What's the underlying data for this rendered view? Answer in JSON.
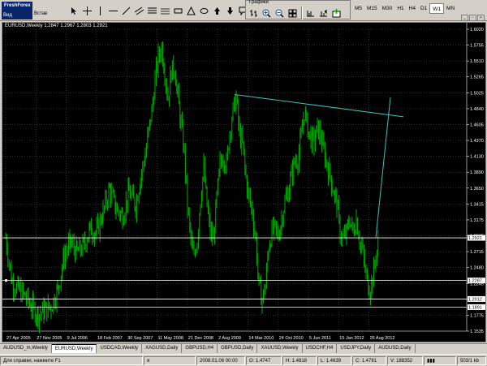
{
  "app": {
    "name": "FreshForex",
    "menu": [
      "Вид",
      "Встав"
    ]
  },
  "floating_toolbar": {
    "title": "Графики"
  },
  "periods": [
    {
      "label": "M5",
      "active": false
    },
    {
      "label": "M15",
      "active": false
    },
    {
      "label": "M30",
      "active": false
    },
    {
      "label": "H1",
      "active": false
    },
    {
      "label": "H4",
      "active": false
    },
    {
      "label": "D1",
      "active": false
    },
    {
      "label": "W1",
      "active": true
    },
    {
      "label": "MN",
      "active": false
    }
  ],
  "chart": {
    "header": "EURUSD,Weekly  1.2847 1.2967 1.2803 1.2921",
    "colors": {
      "background": "#000000",
      "bars": "#00c000",
      "grid": "#5a5a5a",
      "trendline": "#40c0c0",
      "hline": "#ffffff",
      "label": "#ffffff"
    }
  },
  "chart_data": {
    "type": "bar",
    "symbol": "EURUSD",
    "timeframe": "Weekly",
    "ohlc_last": {
      "open": 1.2847,
      "high": 1.2967,
      "low": 1.2803,
      "close": 1.2921
    },
    "ylim": [
      1.1535,
      1.602
    ],
    "y_ticks": [
      "1.6020",
      "1.5755",
      "1.5510",
      "1.5265",
      "1.5025",
      "1.4840",
      "1.4605",
      "1.4370",
      "1.4130",
      "1.3890",
      "1.3650",
      "1.3415",
      "1.3175",
      "1.2935",
      "1.2715",
      "1.2480",
      "1.2245",
      "1.2010",
      "1.1775",
      "1.1535"
    ],
    "x_ticks": [
      "27 Apr 2005",
      "27 Nov 2005",
      "9 Jul 2006",
      "18 Feb 2007",
      "30 Sep 2007",
      "11 May 2008",
      "21 Dec 2008",
      "2 Aug 2009",
      "14 Mar 2010",
      "24 Oct 2010",
      "5 Jun 2011",
      "15 Jan 2012",
      "26 Aug 2012"
    ],
    "price_path": [
      [
        0,
        1.292
      ],
      [
        8,
        1.225
      ],
      [
        16,
        1.215
      ],
      [
        24,
        1.205
      ],
      [
        32,
        1.19
      ],
      [
        40,
        1.178
      ],
      [
        48,
        1.185
      ],
      [
        56,
        1.19
      ],
      [
        64,
        1.215
      ],
      [
        72,
        1.265
      ],
      [
        80,
        1.285
      ],
      [
        88,
        1.27
      ],
      [
        96,
        1.28
      ],
      [
        104,
        1.305
      ],
      [
        112,
        1.3
      ],
      [
        120,
        1.33
      ],
      [
        128,
        1.365
      ],
      [
        136,
        1.335
      ],
      [
        144,
        1.325
      ],
      [
        152,
        1.36
      ],
      [
        160,
        1.34
      ],
      [
        166,
        1.38
      ],
      [
        172,
        1.415
      ],
      [
        176,
        1.45
      ],
      [
        180,
        1.48
      ],
      [
        184,
        1.525
      ],
      [
        188,
        1.56
      ],
      [
        192,
        1.575
      ],
      [
        196,
        1.54
      ],
      [
        200,
        1.5
      ],
      [
        204,
        1.54
      ],
      [
        208,
        1.545
      ],
      [
        212,
        1.5
      ],
      [
        216,
        1.46
      ],
      [
        220,
        1.42
      ],
      [
        224,
        1.34
      ],
      [
        228,
        1.29
      ],
      [
        232,
        1.26
      ],
      [
        236,
        1.29
      ],
      [
        240,
        1.35
      ],
      [
        244,
        1.395
      ],
      [
        248,
        1.34
      ],
      [
        252,
        1.3
      ],
      [
        256,
        1.29
      ],
      [
        260,
        1.35
      ],
      [
        264,
        1.4
      ],
      [
        268,
        1.415
      ],
      [
        272,
        1.4
      ],
      [
        276,
        1.45
      ],
      [
        280,
        1.48
      ],
      [
        284,
        1.5
      ],
      [
        288,
        1.445
      ],
      [
        292,
        1.43
      ],
      [
        296,
        1.38
      ],
      [
        300,
        1.35
      ],
      [
        304,
        1.33
      ],
      [
        308,
        1.29
      ],
      [
        312,
        1.22
      ],
      [
        316,
        1.2
      ],
      [
        320,
        1.22
      ],
      [
        324,
        1.28
      ],
      [
        328,
        1.3
      ],
      [
        332,
        1.305
      ],
      [
        336,
        1.295
      ],
      [
        340,
        1.32
      ],
      [
        344,
        1.345
      ],
      [
        348,
        1.36
      ],
      [
        352,
        1.385
      ],
      [
        356,
        1.405
      ],
      [
        360,
        1.41
      ],
      [
        364,
        1.44
      ],
      [
        368,
        1.48
      ],
      [
        372,
        1.455
      ],
      [
        376,
        1.44
      ],
      [
        380,
        1.435
      ],
      [
        384,
        1.455
      ],
      [
        388,
        1.445
      ],
      [
        392,
        1.42
      ],
      [
        396,
        1.4
      ],
      [
        400,
        1.385
      ],
      [
        404,
        1.36
      ],
      [
        408,
        1.345
      ],
      [
        412,
        1.3
      ],
      [
        416,
        1.29
      ],
      [
        420,
        1.3
      ],
      [
        424,
        1.32
      ],
      [
        428,
        1.3
      ],
      [
        432,
        1.32
      ],
      [
        436,
        1.29
      ],
      [
        440,
        1.27
      ],
      [
        444,
        1.235
      ],
      [
        448,
        1.215
      ],
      [
        452,
        1.23
      ],
      [
        456,
        1.265
      ],
      [
        460,
        1.29
      ]
    ],
    "trendline": {
      "start": [
        286,
        1.505
      ],
      "end": [
        494,
        1.472
      ]
    },
    "projection_line": {
      "start": [
        460,
        1.2921
      ],
      "end": [
        478,
        1.501
      ]
    },
    "hlines": [
      {
        "price": 1.2921,
        "label": "1.2921"
      },
      {
        "price": 1.2287,
        "label": "1.2287"
      },
      {
        "price": 1.2012,
        "label": "1.2012"
      },
      {
        "price": 1.1891,
        "label": "1.1891"
      }
    ],
    "grid": true
  },
  "tabs": [
    {
      "label": "AUDUSD_m,Weekly",
      "active": false
    },
    {
      "label": "EURUSD,Weekly",
      "active": true
    },
    {
      "label": "USDCAD,Weekly",
      "active": false
    },
    {
      "label": "XAGUSD,Daily",
      "active": false
    },
    {
      "label": "GBPUSD,H4",
      "active": false
    },
    {
      "label": "GBPUSD,Daily",
      "active": false
    },
    {
      "label": "XAUUSD,Weekly",
      "active": false
    },
    {
      "label": "USDCHF,H4",
      "active": false
    },
    {
      "label": "USDJPY,Daily",
      "active": false
    },
    {
      "label": "AUDUSD,Daily",
      "active": false
    }
  ],
  "status": {
    "help": "Для справки, нажмите F1",
    "profile": "я",
    "datetime": "2008.01.06 00:00",
    "open": "O: 1.4747",
    "high": "H: 1.4818",
    "low": "L: 1.4639",
    "close": "C: 1.4781",
    "volume": "V: 188352",
    "traffic": "503/1 kb"
  }
}
